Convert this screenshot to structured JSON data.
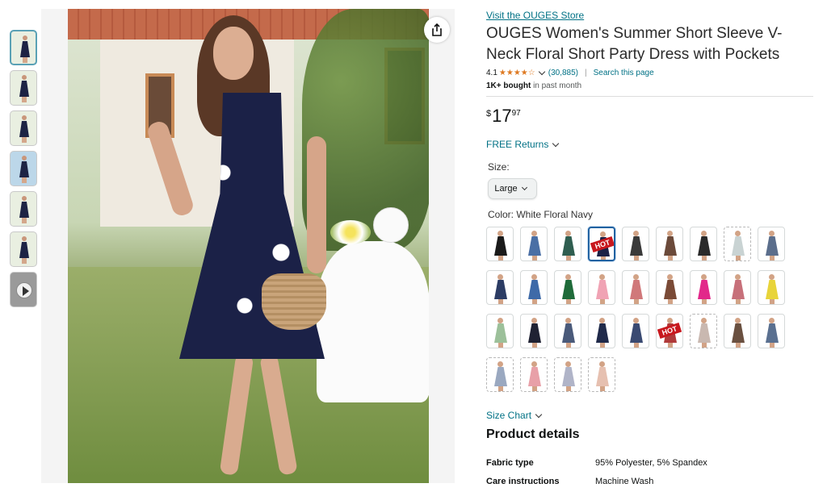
{
  "store_link": "Visit the OUGES Store",
  "title": "OUGES Women's Summer Short Sleeve V-Neck Floral Short Party Dress with Pockets",
  "rating": {
    "value": "4.1",
    "stars": "★★★★☆",
    "count": "(30,885)",
    "search_link": "Search this page"
  },
  "bought": {
    "count": "1K+ bought",
    "suffix": "in past month"
  },
  "price": {
    "symbol": "$",
    "whole": "17",
    "fraction": "97"
  },
  "returns_label": "FREE Returns",
  "size": {
    "label": "Size:",
    "selected": "Large"
  },
  "color": {
    "label": "Color: White Floral Navy"
  },
  "swatches": [
    {
      "color": "#1a1a1a",
      "hot": false,
      "dashed": false
    },
    {
      "color": "#4a6fa5",
      "hot": false,
      "dashed": false
    },
    {
      "color": "#2f5e50",
      "hot": false,
      "dashed": false
    },
    {
      "color": "#1b2147",
      "hot": true,
      "selected": true,
      "dashed": false
    },
    {
      "color": "#3a3a3a",
      "hot": false,
      "dashed": false
    },
    {
      "color": "#6b4a3a",
      "hot": false,
      "dashed": false
    },
    {
      "color": "#2a2a2a",
      "hot": false,
      "dashed": false
    },
    {
      "color": "#c9d3d3",
      "hot": false,
      "dashed": true
    },
    {
      "color": "#5b6e8c",
      "hot": false,
      "dashed": false
    },
    {
      "color": "#2c3c64",
      "hot": false,
      "dashed": false
    },
    {
      "color": "#3e6aa8",
      "hot": false,
      "dashed": false
    },
    {
      "color": "#1f6b3a",
      "hot": false,
      "dashed": false
    },
    {
      "color": "#f0a3b4",
      "hot": false,
      "dashed": false
    },
    {
      "color": "#d0787a",
      "hot": false,
      "dashed": false
    },
    {
      "color": "#7a4a36",
      "hot": false,
      "dashed": false
    },
    {
      "color": "#e2288a",
      "hot": false,
      "dashed": false
    },
    {
      "color": "#c7707a",
      "hot": false,
      "dashed": false
    },
    {
      "color": "#e8d43a",
      "hot": false,
      "dashed": false
    },
    {
      "color": "#9cc09a",
      "hot": false,
      "dashed": false
    },
    {
      "color": "#1f2233",
      "hot": false,
      "dashed": false
    },
    {
      "color": "#4a5a7a",
      "hot": false,
      "dashed": false
    },
    {
      "color": "#202a4a",
      "hot": false,
      "dashed": false
    },
    {
      "color": "#3a4a72",
      "hot": false,
      "dashed": false
    },
    {
      "color": "#b03a3a",
      "hot": true,
      "dashed": false
    },
    {
      "color": "#c9b8b0",
      "hot": false,
      "dashed": true
    },
    {
      "color": "#6a5040",
      "hot": false,
      "dashed": false
    },
    {
      "color": "#5a7090",
      "hot": false,
      "dashed": false
    },
    {
      "color": "#9aa8c0",
      "hot": false,
      "dashed": true
    },
    {
      "color": "#e8a0a8",
      "hot": false,
      "dashed": true
    },
    {
      "color": "#b0b4c8",
      "hot": false,
      "dashed": true
    },
    {
      "color": "#e6c0b0",
      "hot": false,
      "dashed": true
    }
  ],
  "size_chart_label": "Size Chart",
  "product_details": {
    "title": "Product details",
    "rows": [
      {
        "key": "Fabric type",
        "value": "95% Polyester, 5% Spandex"
      },
      {
        "key": "Care instructions",
        "value": "Machine Wash"
      }
    ]
  },
  "hot_label": "HOT",
  "thumbnails": 7
}
